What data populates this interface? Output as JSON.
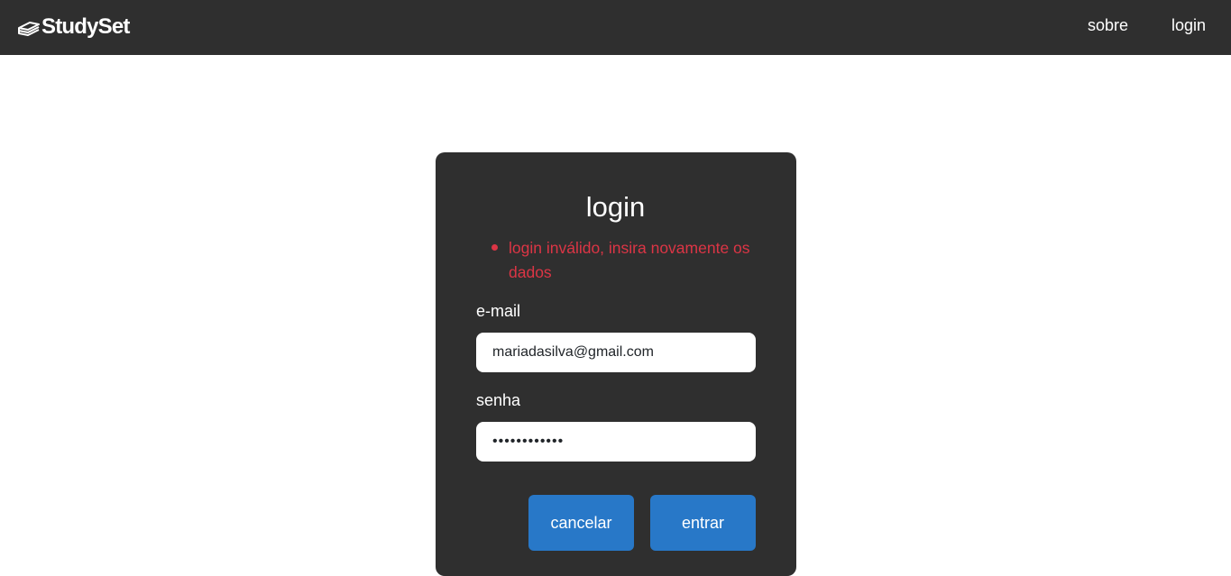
{
  "navbar": {
    "brand": "StudySet",
    "brand_icon": "stacked-books-icon",
    "links": [
      "sobre",
      "login"
    ]
  },
  "login_card": {
    "title": "login",
    "errors": [
      "login inválido, insira novamente os dados"
    ],
    "email_label": "e-mail",
    "email_value": "mariadasilva@gmail.com",
    "password_label": "senha",
    "password_value": "••••••••••••",
    "cancel_label": "cancelar",
    "submit_label": "entrar"
  },
  "colors": {
    "navbar_bg": "#2f2f2f",
    "card_bg": "#2f2f2f",
    "error": "#dc3545",
    "button": "#2878c8"
  }
}
